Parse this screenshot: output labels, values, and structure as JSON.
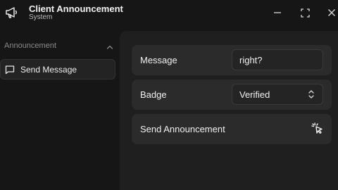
{
  "window": {
    "title": "Client Announcement",
    "subtitle": "System",
    "icons": [
      "megaphone-icon",
      "minimize-icon",
      "maximize-icon",
      "close-icon"
    ]
  },
  "sidebar": {
    "section_label": "Announcement",
    "section_icon": "chevron-up-icon",
    "items": [
      {
        "label": "Send Message",
        "icon": "message-square-icon"
      }
    ]
  },
  "form": {
    "message": {
      "label": "Message",
      "value": "right?"
    },
    "badge": {
      "label": "Badge",
      "value": "Verified",
      "icon": "chevron-up-down-icon"
    },
    "send": {
      "label": "Send Announcement",
      "icon": "pointer-click-icon"
    }
  },
  "colors": {
    "background": "#161616",
    "panel": "#1f1f1f",
    "card": "#2b2b2b",
    "text": "#f0f0f0",
    "muted": "#8a8a8a"
  }
}
